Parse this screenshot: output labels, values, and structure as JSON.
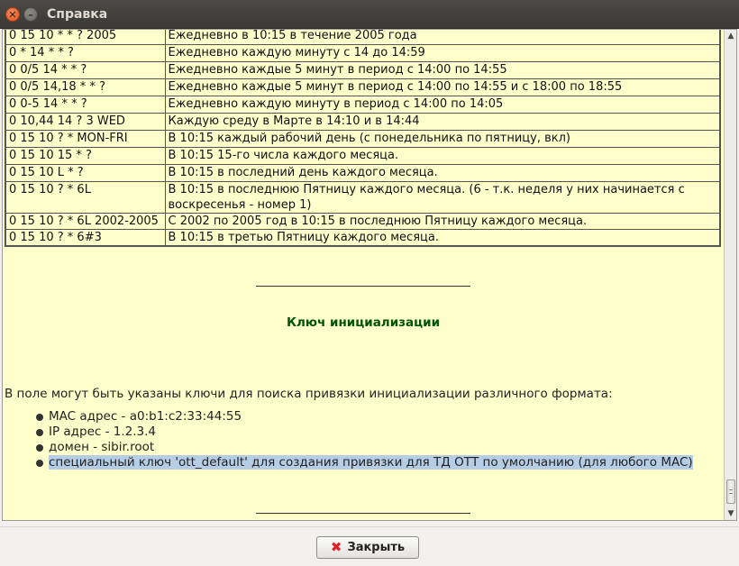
{
  "window": {
    "title": "Справка",
    "close_glyph": "✕",
    "minimize_glyph": "–"
  },
  "cron_table": {
    "rows": [
      {
        "expr": "0 15 10 * * ? 2005",
        "desc": "Ежедневно в 10:15 в течение 2005 года"
      },
      {
        "expr": "0 * 14 * * ?",
        "desc": "Ежедневно каждую минуту с 14 до 14:59"
      },
      {
        "expr": "0 0/5 14 * * ?",
        "desc": "Ежедневно каждые 5 минут в период с 14:00 по 14:55"
      },
      {
        "expr": "0 0/5 14,18 * * ?",
        "desc": "Ежедневно каждые 5 минут в период с 14:00 по 14:55 и с 18:00 по 18:55"
      },
      {
        "expr": "0 0-5 14 * * ?",
        "desc": "Ежедневно каждую минуту в период с 14:00 по 14:05"
      },
      {
        "expr": "0 10,44 14 ? 3 WED",
        "desc": "Каждую среду в Марте в 14:10 и в 14:44"
      },
      {
        "expr": "0 15 10 ? * MON-FRI",
        "desc": "В 10:15 каждый рабочий день (с понедельника по пятницу, вкл)"
      },
      {
        "expr": "0 15 10 15 * ?",
        "desc": "В 10:15 15-го числа каждого месяца."
      },
      {
        "expr": "0 15 10 L * ?",
        "desc": "В 10:15 в последний день каждого месяца."
      },
      {
        "expr": "0 15 10 ? * 6L",
        "desc": "В 10:15 в последнюю Пятницу каждого месяца. (6 - т.к. неделя у них начинается с воскресенья - номер 1)"
      },
      {
        "expr": "0 15 10 ? * 6L 2002-2005",
        "desc": "С 2002 по 2005 год в 10:15 в последнюю Пятницу каждого месяца."
      },
      {
        "expr": "0 15 10 ? * 6#3",
        "desc": "В 10:15 в третью Пятницу каждого месяца."
      }
    ]
  },
  "section": {
    "heading": "Ключ инициализации",
    "paragraph": "В поле могут быть указаны ключи для поиска привязки инициализации различного формата:",
    "items": [
      {
        "text": "MAC адрес - a0:b1:c2:33:44:55",
        "selected": false
      },
      {
        "text": "IP адрес - 1.2.3.4",
        "selected": false
      },
      {
        "text": "домен - sibir.root",
        "selected": false
      },
      {
        "text": "специальный ключ 'ott_default' для создания привязки для ТД ОТТ по умолчанию (для любого MAC)",
        "selected": true
      }
    ]
  },
  "scrollbar": {
    "position_fraction": 0.96
  },
  "footer": {
    "close_label": "Закрыть",
    "close_icon": "close-x-icon"
  },
  "colors": {
    "content_bg": "#ffffcc",
    "heading": "#005500",
    "selection": "#b6cde6",
    "close_icon": "#dd2222"
  }
}
